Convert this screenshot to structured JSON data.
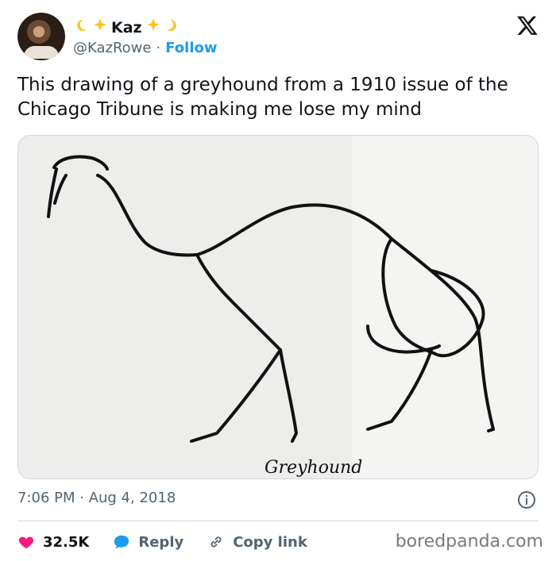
{
  "author": {
    "name": "Kaz",
    "handle": "@KazRowe",
    "separator": "·",
    "follow_label": "Follow"
  },
  "tweet": {
    "text": "This drawing of a greyhound from a 1910 issue of the Chicago Tribune is making me lose my mind",
    "timestamp": "7:06 PM · Aug 4, 2018"
  },
  "image": {
    "caption": "Greyhound"
  },
  "actions": {
    "likes": "32.5K",
    "reply_label": "Reply",
    "copy_link_label": "Copy link"
  },
  "watermark": "boredpanda.com",
  "colors": {
    "like": "#f91880",
    "reply": "#1d9bf0",
    "follow": "#1d9bf0",
    "secondary_text": "#536471"
  }
}
